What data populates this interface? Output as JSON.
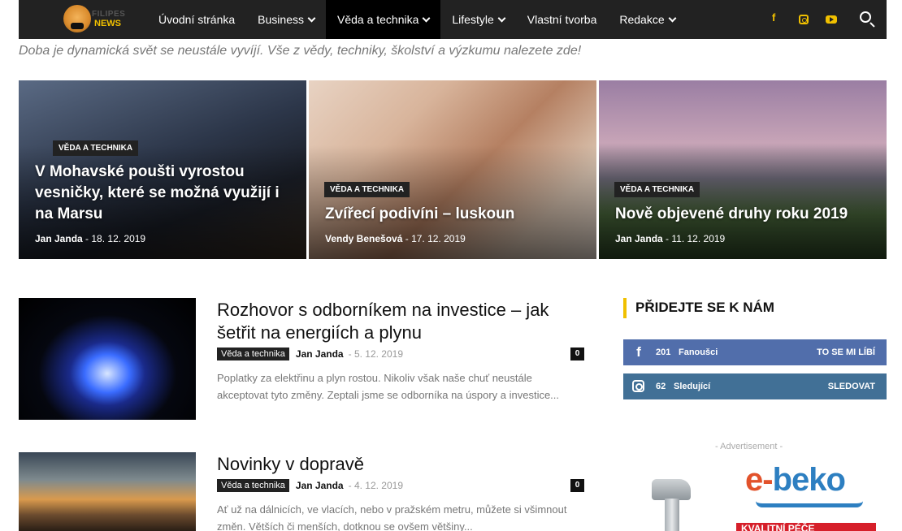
{
  "logo": {
    "line1": "FILIPES",
    "line2": "NEWS"
  },
  "nav": {
    "items": [
      {
        "label": "Úvodní stránka",
        "dropdown": false
      },
      {
        "label": "Business",
        "dropdown": true
      },
      {
        "label": "Věda a technika",
        "dropdown": true,
        "active": true
      },
      {
        "label": "Lifestyle",
        "dropdown": true
      },
      {
        "label": "Vlastní tvorba",
        "dropdown": false
      },
      {
        "label": "Redakce",
        "dropdown": true
      }
    ],
    "social_icons": [
      "facebook-icon",
      "instagram-icon",
      "youtube-icon"
    ],
    "search_icon": "search-icon",
    "accent": "#f0c000",
    "bg": "#222222"
  },
  "tagline": "Doba je dynamická svět se neustále vyvíjí. Vše z vědy, techniky, školství a výzkumu nalezete zde!",
  "featured": [
    {
      "category": "VĚDA A TECHNIKA",
      "title": "V Mohavské poušti vyrostou vesničky, které se možná využijí i na Marsu",
      "author": "Jan Janda",
      "date": "18. 12. 2019"
    },
    {
      "category": "VĚDA A TECHNIKA",
      "title": "Zvířecí podivíni – luskoun",
      "author": "Vendy Benešová",
      "date": "17. 12. 2019"
    },
    {
      "category": "VĚDA A TECHNIKA",
      "title": "Nově objevené druhy roku 2019",
      "author": "Jan Janda",
      "date": "11. 12. 2019"
    }
  ],
  "articles": [
    {
      "title": "Rozhovor s odborníkem na investice – jak šetřit na energiích a plynu",
      "category": "Věda a technika",
      "author": "Jan Janda",
      "date": "5. 12. 2019",
      "comments": "0",
      "excerpt": "Poplatky za elektřinu a plyn rostou. Nikoliv však naše chuť neustále akceptovat tyto změny. Zeptali jsme se odborníka na úspory a investice..."
    },
    {
      "title": "Novinky v dopravě",
      "category": "Věda a technika",
      "author": "Jan Janda",
      "date": "4. 12. 2019",
      "comments": "0",
      "excerpt": "Ať už na dálnicích, ve vlacích, nebo v pražském metru, můžete si všimnout změn. Větších či menších, dotknou se ovšem většiny..."
    }
  ],
  "sidebar": {
    "title": "PŘIDEJTE SE K NÁM",
    "facebook": {
      "count": "201",
      "label": "Fanoušci",
      "action": "TO SE MI LÍBÍ",
      "color": "#516eab"
    },
    "instagram": {
      "count": "62",
      "label": "Sledující",
      "action": "SLEDOVAT",
      "color": "#417096"
    },
    "ad_label": "- Advertisement -",
    "ad": {
      "brand_e": "e-",
      "brand_rest": "beko",
      "banner": "KVALITNÍ PÉČE"
    }
  }
}
